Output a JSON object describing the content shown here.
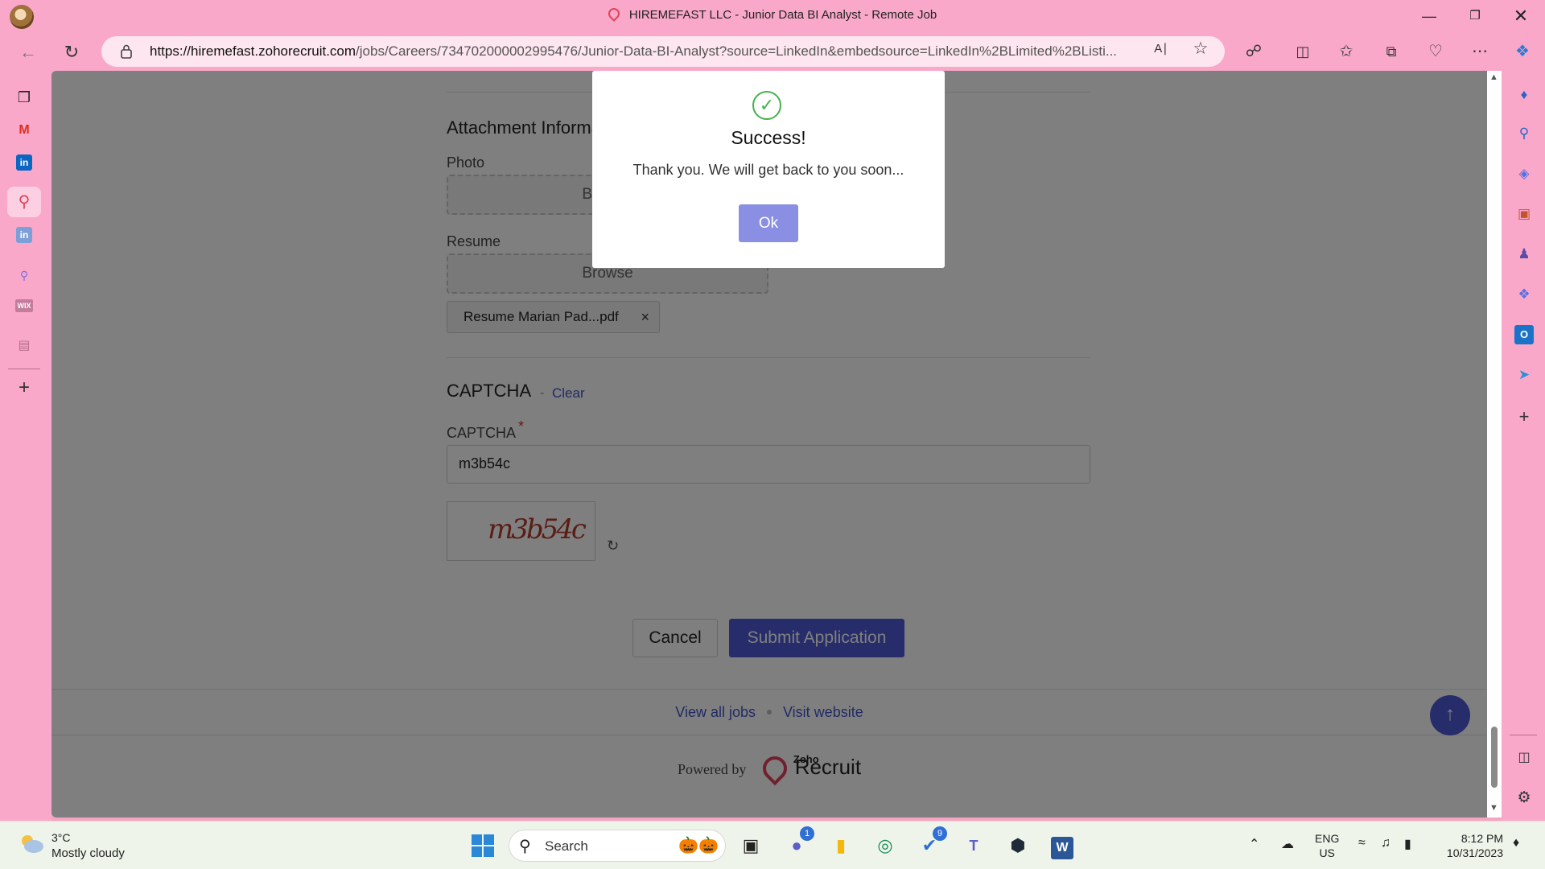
{
  "browser": {
    "tab_title": "HIREMEFAST LLC - Junior Data BI Analyst - Remote Job",
    "url_host": "https://hiremefast.zohorecruit.com",
    "url_path": "/jobs/Careers/734702000002995476/Junior-Data-BI-Analyst?source=LinkedIn&embedsource=LinkedIn%2BLimited%2BListi...",
    "window_controls": [
      "minimize-icon",
      "restore-icon",
      "close-icon"
    ]
  },
  "left_sidebar": {
    "items": [
      "tabs-icon",
      "gmail-icon",
      "linkedin-icon",
      "zoho-recruit-icon",
      "linkedin-icon",
      "search-icon",
      "wix-icon",
      "calendar-icon",
      "add-icon"
    ]
  },
  "right_sidebar": {
    "items": [
      "bell-icon",
      "search-icon",
      "shopping-tag-icon",
      "toolbox-icon",
      "games-icon",
      "copilot-icon",
      "outlook-icon",
      "send-icon",
      "add-icon",
      "sidebar-toggle-icon",
      "settings-icon"
    ]
  },
  "form": {
    "attachment_title": "Attachment Information",
    "photo_label": "Photo",
    "photo_browse": "Browse",
    "resume_label": "Resume",
    "resume_browse": "Browse",
    "resume_file": "Resume Marian Pad...pdf",
    "remove_symbol": "×",
    "captcha_title": "CAPTCHA",
    "captcha_separator": "-",
    "clear_label": "Clear",
    "captcha_field_label": "CAPTCHA",
    "required_mark": "*",
    "captcha_value": "m3b54c",
    "captcha_image_text": "m3b54c",
    "cancel_label": "Cancel",
    "submit_label": "Submit Application"
  },
  "footer": {
    "view_all_jobs": "View all jobs",
    "visit_website": "Visit website",
    "powered_by": "Powered by",
    "brand_small": "Zoho",
    "brand_big": "Recruit"
  },
  "modal": {
    "title": "Success!",
    "message": "Thank you. We will get back to you soon...",
    "ok_label": "Ok"
  },
  "taskbar": {
    "weather_temp": "3°C",
    "weather_desc": "Mostly cloudy",
    "search_placeholder": "Search",
    "chat_badge": "1",
    "todo_badge": "9",
    "lang_top": "ENG",
    "lang_bottom": "US",
    "time": "8:12 PM",
    "date": "10/31/2023"
  },
  "colors": {
    "browser_chrome": "#f9a8c9",
    "accent": "#4e5bd6",
    "success": "#47b04b",
    "ok_button": "#8b8fe3"
  }
}
